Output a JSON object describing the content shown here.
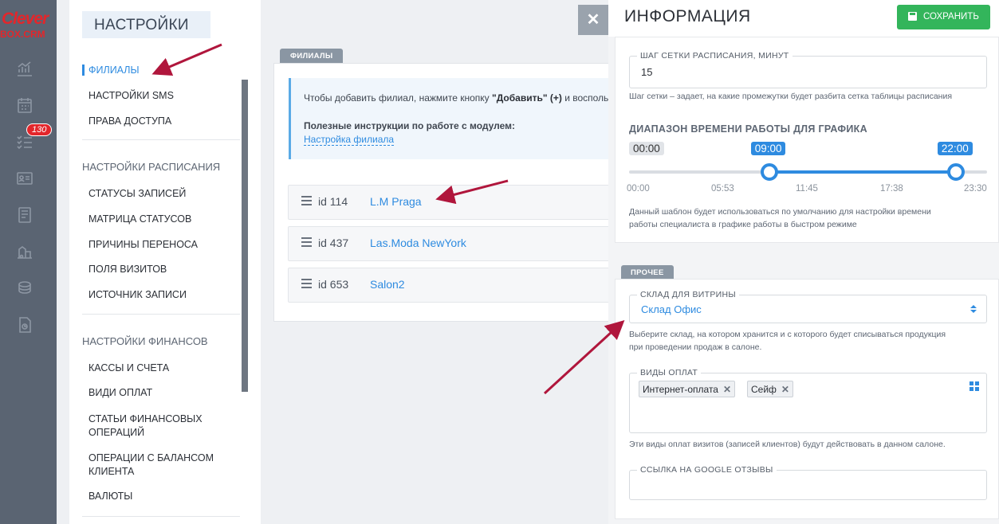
{
  "logo": {
    "line1": "Clever",
    "line2": "BOX.CRM"
  },
  "rail": {
    "badge_count": "130",
    "icons": [
      "analytics-icon",
      "calendar-icon",
      "tasks-icon",
      "contacts-card-icon",
      "journal-icon",
      "warehouse-icon",
      "coins-icon",
      "document-icon"
    ]
  },
  "settings": {
    "title": "НАСТРОЙКИ",
    "group1": [
      "ФИЛИАЛЫ",
      "НАСТРОЙКИ SMS",
      "ПРАВА ДОСТУПА"
    ],
    "schedule_head": "НАСТРОЙКИ РАСПИСАНИЯ",
    "group2": [
      "СТАТУСЫ ЗАПИСЕЙ",
      "МАТРИЦА СТАТУСОВ",
      "ПРИЧИНЫ ПЕРЕНОСА",
      "ПОЛЯ ВИЗИТОВ",
      "ИСТОЧНИК ЗАПИСИ"
    ],
    "finance_head": "НАСТРОЙКИ ФИНАНСОВ",
    "group3": [
      "КАССЫ И СЧЕТА",
      "ВИДИ ОПЛАТ",
      "СТАТЬИ ФИНАНСОВЫХ",
      "ОПЕРАЦИЙ",
      "ОПЕРАЦИИ С БАЛАНСОМ",
      "КЛИЕНТА",
      "ВАЛЮТЫ"
    ]
  },
  "branches": {
    "tab": "ФИЛИАЛЫ",
    "info_text_pre": "Чтобы добавить филиал, нажмите кнопку ",
    "info_text_bold": "\"Добавить\" (+)",
    "info_text_post": " и воспольз",
    "info_strong": "Полезные инструкции по работе с модулем:",
    "info_link": "Настройка филиала",
    "items": [
      {
        "id": "id 114",
        "name": "L.M Praga"
      },
      {
        "id": "id 437",
        "name": "Las.Moda NewYork"
      },
      {
        "id": "id 653",
        "name": "Salon2"
      }
    ]
  },
  "close_label": "✕",
  "panel": {
    "title": "ИНФОРМАЦИЯ",
    "save_label": "СОХРАНИТЬ",
    "grid_step": {
      "label": "ШАГ СЕТКИ РАСПИСАНИЯ, МИНУТ",
      "value": "15",
      "hint": "Шаг сетки – задает, на какие промежутки будет разбита сетка таблицы расписания"
    },
    "work_range": {
      "head": "ДИАПАЗОН ВРЕМЕНИ РАБОТЫ ДЛЯ ГРАФИКА",
      "min_label": "00:00",
      "from": "09:00",
      "to": "22:00",
      "from_fraction": 0.3913,
      "to_fraction": 0.913,
      "ticks": [
        "00:00",
        "05:53",
        "11:45",
        "17:38",
        "23:30"
      ],
      "hint_line1": "Данный шаблон будет использоваться по умолчанию для настройки времени",
      "hint_line2": "работы специалиста в графике работы в быстром режиме"
    },
    "other_tab": "ПРОЧЕЕ",
    "warehouse": {
      "label": "СКЛАД ДЛЯ ВИТРИНЫ",
      "value": "Склад Офис",
      "hint_line1": "Выберите склад, на котором хранится и с которого будет списываться продукция",
      "hint_line2": "при проведении продаж в салоне."
    },
    "payment_types": {
      "label": "ВИДЫ ОПЛАТ",
      "tags": [
        "Интернет-оплата",
        "Сейф"
      ],
      "hint": "Эти виды оплат визитов (записей клиентов) будут действовать в данном салоне."
    },
    "google": {
      "label": "ССЫЛКА НА GOOGLE ОТЗЫВЫ",
      "value": ""
    }
  },
  "colors": {
    "accent": "#2e8be0",
    "save": "#33b55b",
    "rail": "#5a6472",
    "arrow": "#b0163c"
  }
}
